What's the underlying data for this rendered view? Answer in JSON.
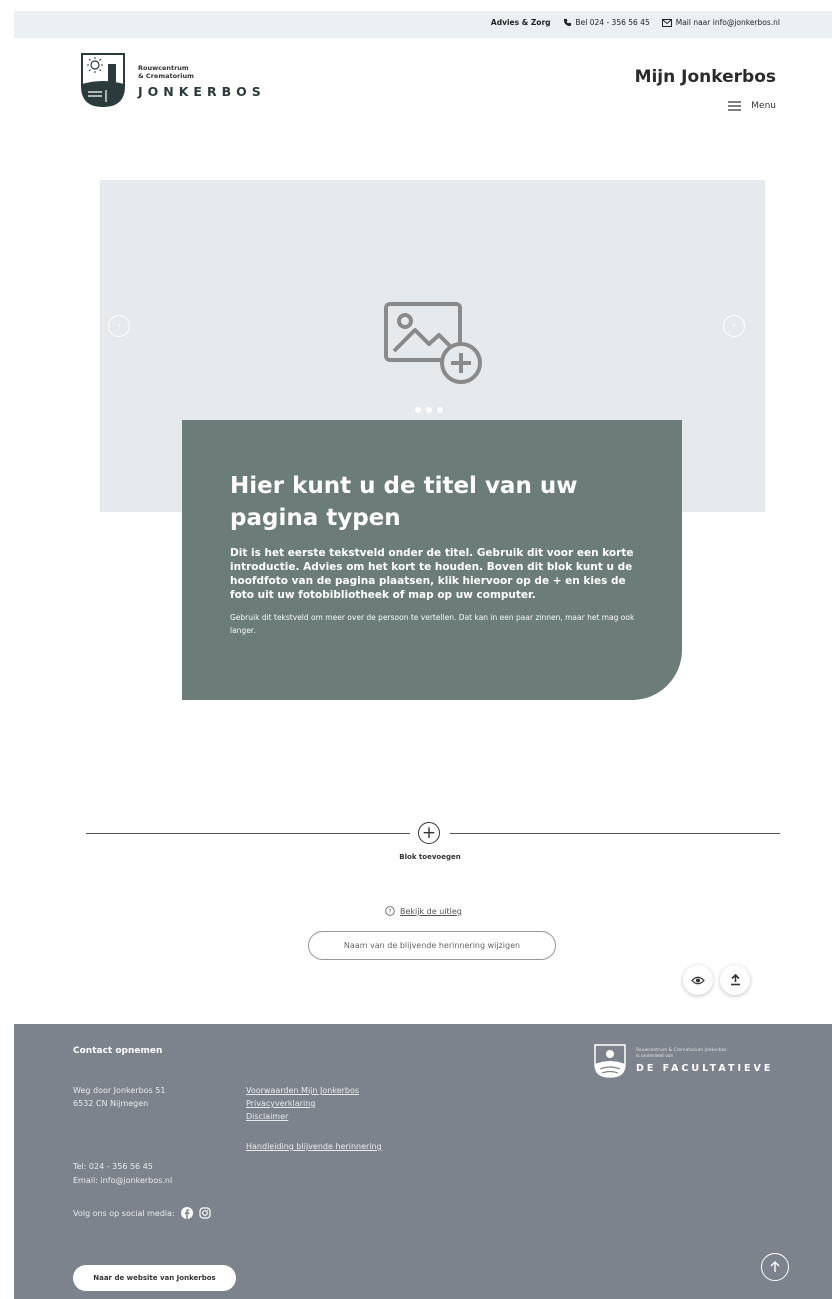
{
  "topbar": {
    "advies": "Advies & Zorg",
    "phone": "Bel 024 - 356 56 45",
    "mail": "Mail naar info@jonkerbos.nl"
  },
  "header": {
    "logo_sub_1": "Rouwcentrum",
    "logo_sub_2": "& Crematorium",
    "logo_name": "JONKERBOS",
    "mijn": "Mijn Jonkerbos",
    "menu": "Menu"
  },
  "hero": {
    "prev_icon": "chevron-left-icon",
    "next_icon": "chevron-right-icon",
    "slide_count": 3,
    "active_slide": 1
  },
  "card": {
    "title": "Hier kunt u de titel van uw pagina typen",
    "intro": "Dit is het eerste tekstveld onder de titel. Gebruik dit voor een korte introductie. Advies om het kort te houden. Boven dit blok kunt u de hoofdfoto van de pagina plaatsen, klik hiervoor op de + en kies de foto uit uw fotobibliotheek of map op uw computer.",
    "body": "Gebruik dit tekstveld om meer over de persoon te vertellen. Dat kan in een paar zinnen, maar het mag ook langer."
  },
  "editor": {
    "add_block": "Blok toevoegen",
    "explain": "Bekijk de uitleg",
    "rename": "Naam van de blijvende herinnering wijzigen"
  },
  "footer": {
    "title": "Contact opnemen",
    "addr_1": "Weg door Jonkerbos 51",
    "addr_2": "6532 CN Nijmegen",
    "links": [
      "Voorwaarden Mijn Jonkerbos",
      "Privacyverklaring",
      "Disclaimer"
    ],
    "manual": "Handleiding blijvende herinnering",
    "tel": "Tel: 024 - 356 56 45",
    "email": "Email: info@jonkerbos.nl",
    "social": "Volg ons op social media:",
    "site_button": "Naar de website van Jonkerbos",
    "logo_sub_1": "Rouwcentrum & Crematorium Jonkerbos",
    "logo_sub_2": "is onderdeel van",
    "logo_name": "DE FACULTATIEVE"
  },
  "colors": {
    "card": "#6c7d79",
    "footer": "#7d838c",
    "hero": "#e7eaed",
    "topbar": "#ecf0f3"
  }
}
